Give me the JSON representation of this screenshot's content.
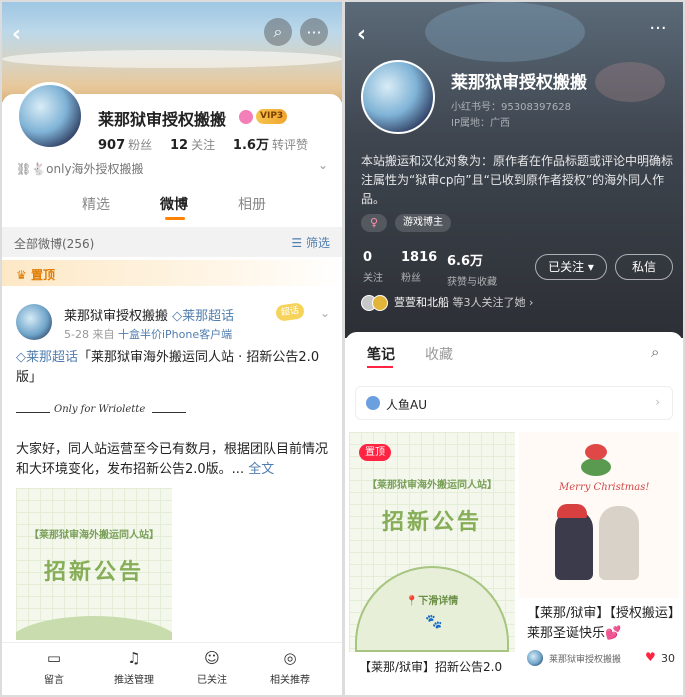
{
  "left": {
    "profile": {
      "name": "莱那狱审授权搬搬",
      "vip_label": "VIP3",
      "fans_count": "907",
      "fans_label": "粉丝",
      "following_count": "12",
      "following_label": "关注",
      "reposts_count": "1.6万",
      "reposts_label": "转评赞",
      "tagline": "⛓🐇only海外授权搬搬"
    },
    "tabs": [
      "精选",
      "微博",
      "相册"
    ],
    "filter": {
      "all_label": "全部微博(256)",
      "filter_label": "筛选"
    },
    "pinned_label": "置顶",
    "post": {
      "author": "莱那狱审授权搬搬",
      "super_topic": "莱那超话",
      "chip": "超话",
      "date": "5-28",
      "source_prefix": "来自",
      "source": "十盒半价iPhone客户端",
      "title_tag": "莱那超话",
      "title_text": "「莱那狱审海外搬运同人站 · 招新公告2.0版」",
      "only_for": "Only for Wriolette",
      "body": "大家好，同人站运营至今已有数月，根据团队目前情况和大环境变化，发布招新公告2.0版。...",
      "full_text": "全文",
      "image_header": "【莱那狱审海外搬运同人站】",
      "image_title": "招新公告"
    },
    "bottom_bar": [
      {
        "icon": "message-icon",
        "label": "留言"
      },
      {
        "icon": "bell-icon",
        "label": "推送管理"
      },
      {
        "icon": "user-check-icon",
        "label": "已关注"
      },
      {
        "icon": "recommend-icon",
        "label": "相关推荐"
      }
    ]
  },
  "right": {
    "profile": {
      "name": "莱那狱审授权搬搬",
      "id_text": "小红书号：95308397628",
      "ip_text": "IP属地：广西",
      "bio": "本站搬运和汉化对象为：原作者在作品标题或评论中明确标注属性为“狱审cp向”且“已收到原作者授权”的海外同人作品。",
      "gender_symbol": "♀",
      "tag": "游戏博主",
      "stats": [
        {
          "value": "0",
          "label": "关注"
        },
        {
          "value": "1816",
          "label": "粉丝"
        },
        {
          "value": "6.6万",
          "label": "获赞与收藏"
        }
      ],
      "follow_button": "已关注",
      "message_button": "私信",
      "mutual_names": "萱萱和北船",
      "mutual_suffix": "等3人关注了她"
    },
    "tabs": [
      "笔记",
      "收藏"
    ],
    "collection": "人鱼AU",
    "notes": [
      {
        "pinned_label": "置顶",
        "image_header": "【莱那狱审海外搬运同人站】",
        "image_title": "招新公告",
        "image_sub": "下滑详情",
        "caption": "【莱那/狱审】招新公告2.0"
      },
      {
        "image_text": "Merry Christmas!",
        "caption": "【莱那/狱审】【授权搬运】莱那圣诞快乐💕",
        "author": "莱那狱审授权搬搬",
        "likes": "30"
      }
    ]
  },
  "colors": {
    "weibo_orange": "#ff8200",
    "weibo_link": "#507daf",
    "xhs_red": "#ff2442"
  }
}
